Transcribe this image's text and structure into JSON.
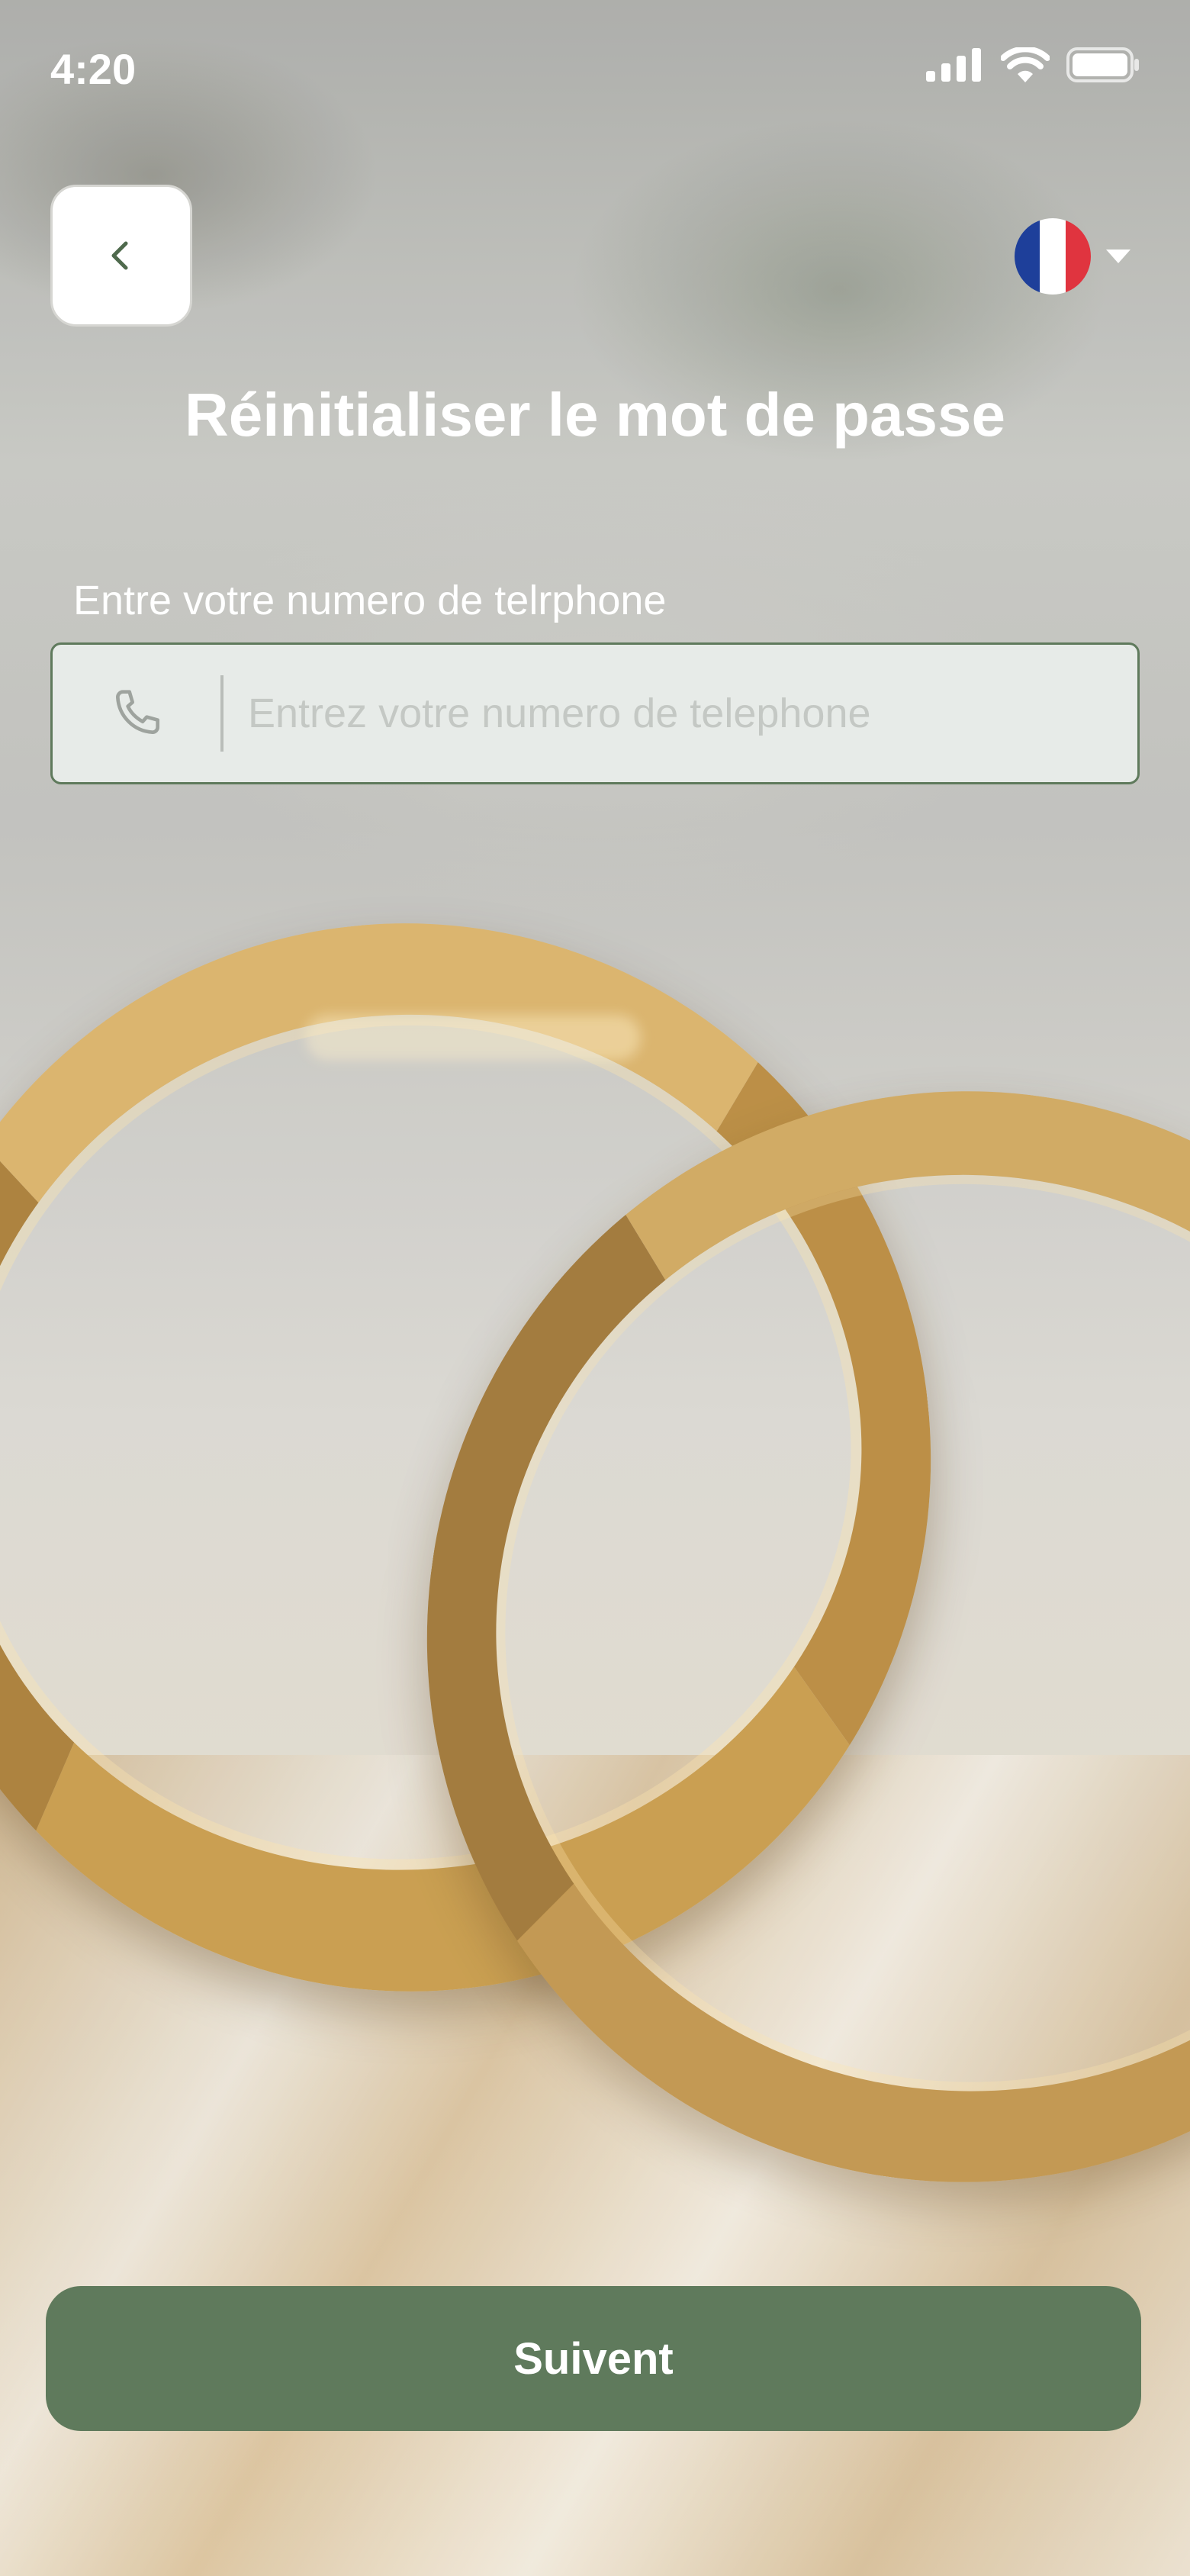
{
  "status_bar": {
    "time": "4:20",
    "icons": [
      "cellular-signal-icon",
      "wifi-icon",
      "battery-icon"
    ]
  },
  "header": {
    "back_icon": "chevron-left-icon",
    "language": {
      "flag": "france-flag-icon",
      "dropdown_icon": "caret-down-icon",
      "flag_colors": [
        "#1e3f9a",
        "#ffffff",
        "#e0343f"
      ]
    }
  },
  "title": "Réinitialiser le mot de passe",
  "form": {
    "label": "Entre votre numero de telrphone",
    "phone_icon": "phone-icon",
    "placeholder": "Entrez votre numero de telephone",
    "value": ""
  },
  "submit": {
    "label": "Suivent"
  },
  "colors": {
    "accent": "#5f7a5c",
    "field_bg": "#e7ebe8",
    "text_light": "#ffffff"
  }
}
